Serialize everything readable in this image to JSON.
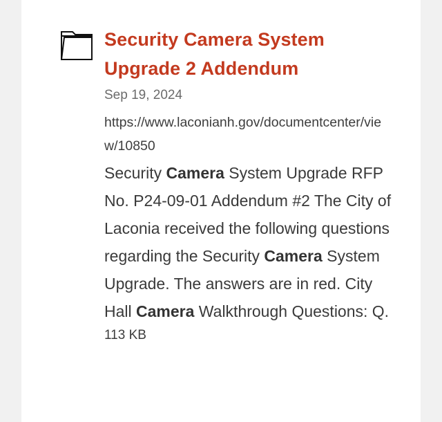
{
  "result": {
    "icon": "folder-icon",
    "title": "Security Camera System Upgrade 2 Addendum",
    "date": "Sep 19, 2024",
    "url": "https://www.laconianh.gov/documentcenter/view/10850",
    "snippet": [
      {
        "text": "Security ",
        "bold": false
      },
      {
        "text": "Camera",
        "bold": true
      },
      {
        "text": " System Upgrade RFP No. P24-09-01 Addendum #2 The City of Laconia received the following questions regarding the Security ",
        "bold": false
      },
      {
        "text": "Camera",
        "bold": true
      },
      {
        "text": " System Upgrade. The answers are in red. City Hall ",
        "bold": false
      },
      {
        "text": "Camera",
        "bold": true
      },
      {
        "text": " Walkthrough Questions: Q.",
        "bold": false
      }
    ],
    "size": "113 KB"
  },
  "colors": {
    "title": "#c33a1f",
    "background": "#f1f1f1",
    "card": "#ffffff"
  }
}
